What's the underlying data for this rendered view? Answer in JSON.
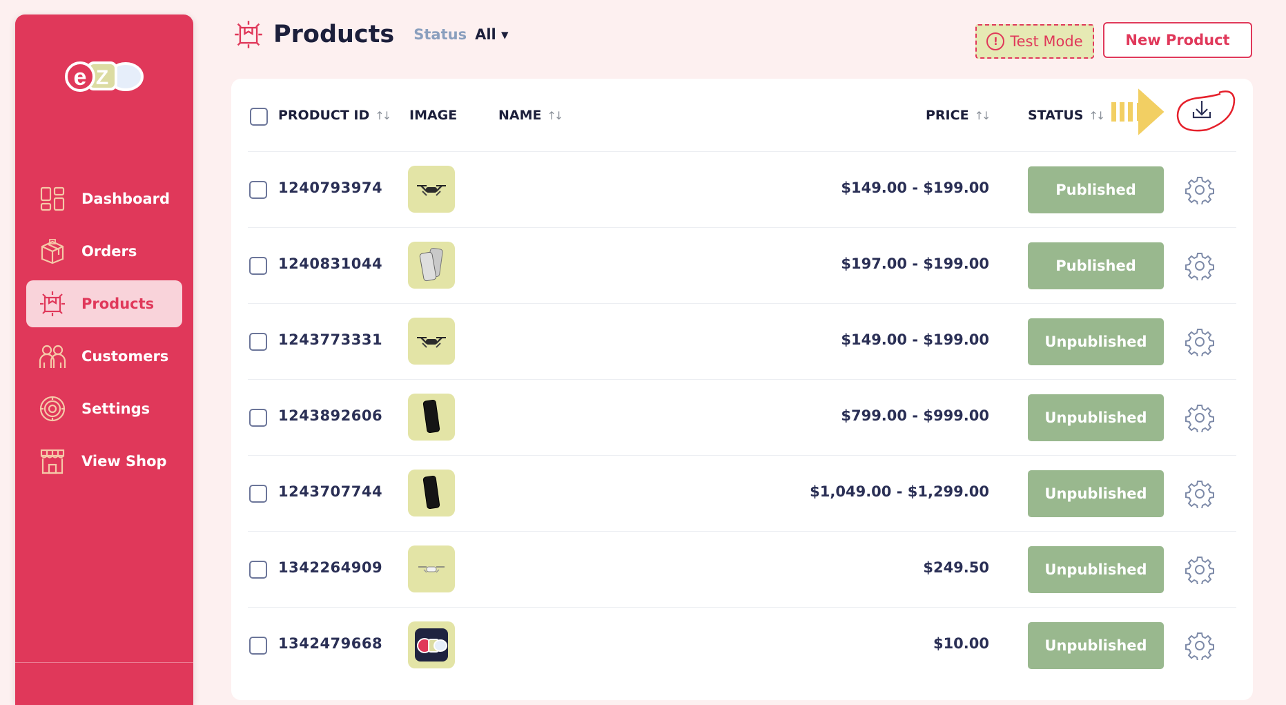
{
  "sidebar": {
    "logo": "eZe",
    "items": [
      {
        "label": "Dashboard",
        "icon": "dashboard-icon"
      },
      {
        "label": "Orders",
        "icon": "orders-box-icon"
      },
      {
        "label": "Products",
        "icon": "products-box-icon",
        "active": true
      },
      {
        "label": "Customers",
        "icon": "customers-icon"
      },
      {
        "label": "Settings",
        "icon": "settings-icon"
      },
      {
        "label": "View Shop",
        "icon": "shop-icon"
      }
    ]
  },
  "header": {
    "title": "Products",
    "status_label": "Status",
    "status_value": "All ▾",
    "test_mode_label": "Test Mode",
    "new_product_label": "New Product"
  },
  "table": {
    "columns": {
      "product_id": "PRODUCT ID",
      "image": "IMAGE",
      "name": "NAME",
      "price": "PRICE",
      "status": "STATUS"
    },
    "rows": [
      {
        "id": "1240793974",
        "image": "drone",
        "price": "$149.00 - $199.00",
        "status": "Published"
      },
      {
        "id": "1240831044",
        "image": "phone-silver",
        "price": "$197.00 - $199.00",
        "status": "Published"
      },
      {
        "id": "1243773331",
        "image": "drone",
        "price": "$149.00 - $199.00",
        "status": "Unpublished"
      },
      {
        "id": "1243892606",
        "image": "phone-black",
        "price": "$799.00 - $999.00",
        "status": "Unpublished"
      },
      {
        "id": "1243707744",
        "image": "phone-black",
        "price": "$1,049.00 - $1,299.00",
        "status": "Unpublished"
      },
      {
        "id": "1342264909",
        "image": "drone-white",
        "price": "$249.50",
        "status": "Unpublished"
      },
      {
        "id": "1342479668",
        "image": "eze-logo",
        "price": "$10.00",
        "status": "Unpublished"
      }
    ]
  },
  "colors": {
    "brand": "#e0385a",
    "published": "#99b88e",
    "background": "#fdf0f0"
  }
}
